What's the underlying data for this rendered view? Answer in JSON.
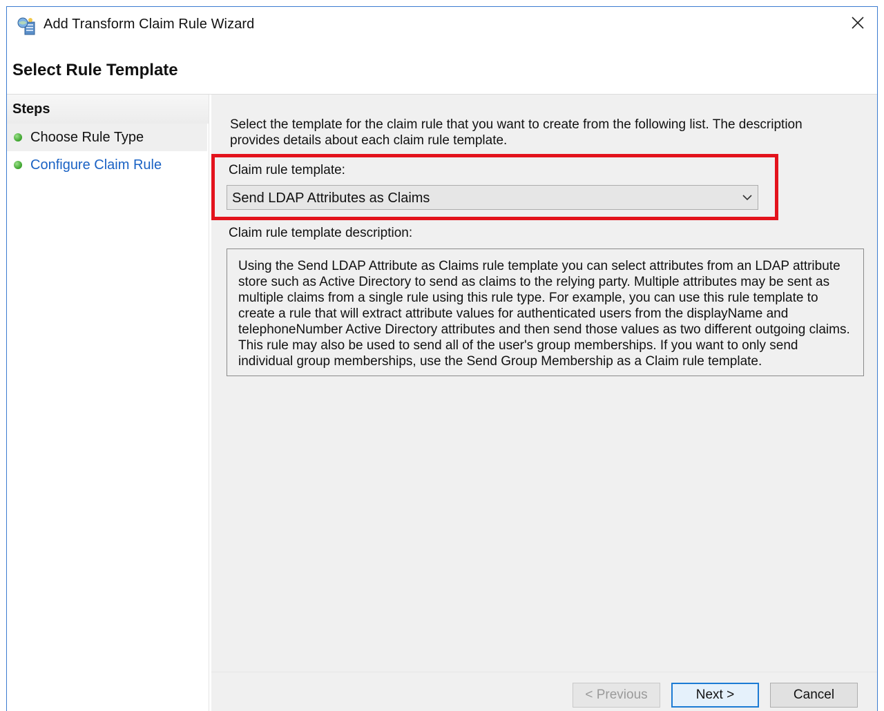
{
  "window": {
    "title": "Add Transform Claim Rule Wizard",
    "app_icon": "server-wizard-icon",
    "close_icon": "close-icon"
  },
  "header": {
    "page_title": "Select Rule Template"
  },
  "steps": {
    "title": "Steps",
    "items": [
      {
        "label": "Choose Rule Type",
        "status_icon": "green-dot-icon"
      },
      {
        "label": "Configure Claim Rule",
        "status_icon": "green-dot-icon"
      }
    ]
  },
  "main": {
    "intro": "Select the template for the claim rule that you want to create from the following list. The description provides details about each claim rule template.",
    "template_label": "Claim rule template:",
    "template_selected": "Send LDAP Attributes as Claims",
    "description_label": "Claim rule template description:",
    "description_text": "Using the Send LDAP Attribute as Claims rule template you can select attributes from an LDAP attribute store such as Active Directory to send as claims to the relying party. Multiple attributes may be sent as multiple claims from a single rule using this rule type. For example, you can use this rule template to create a rule that will extract attribute values for authenticated users from the displayName and telephoneNumber Active Directory attributes and then send those values as two different outgoing claims. This rule may also be used to send all of the user's group memberships. If you want to only send individual group memberships, use the Send Group Membership as a Claim rule template."
  },
  "footer": {
    "previous_label": "< Previous",
    "next_label": "Next >",
    "cancel_label": "Cancel"
  },
  "colors": {
    "highlight": "#e3131c",
    "link": "#1a62c4",
    "focus": "#1b7bd4"
  }
}
